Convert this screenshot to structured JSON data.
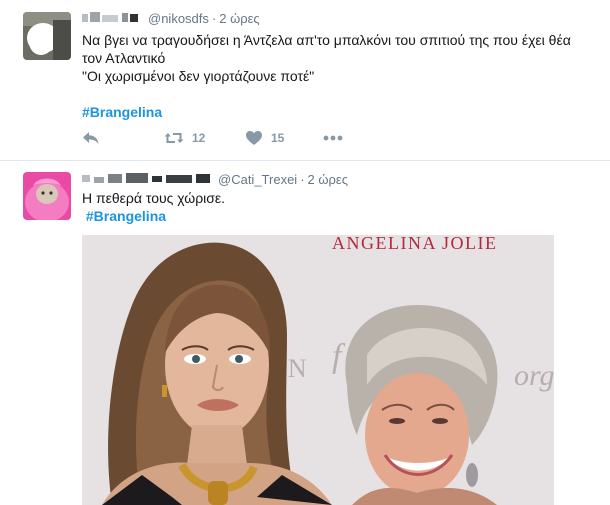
{
  "tweets": [
    {
      "handle": "@nikosdfs",
      "separator": "·",
      "time": "2 ώρες",
      "text_lines": [
        "Να βγει να τραγουδήσει η Άντζελα απ'το μπαλκόνι του σπιτιού της που έχει θέα",
        "τον Ατλαντικό",
        "\"Οι χωρισμένοι δεν γιορτάζουνε ποτέ\""
      ],
      "hashtag": "#Brangelina",
      "retweet_count": "12",
      "like_count": "15",
      "icons": [
        "reply-icon",
        "retweet-icon",
        "heart-icon",
        "more-dots-icon"
      ]
    },
    {
      "handle": "@Cati_Trexei",
      "separator": "·",
      "time": "2 ώρες",
      "text_lines": [
        "Η πεθερά τους χώρισε."
      ],
      "hashtag": "#Brangelina",
      "media_text": "ANGELINA JOLIE",
      "media_backdrop_fragments": [
        "EN",
        "f",
        "org"
      ]
    }
  ],
  "colors": {
    "hashtag": "#1b95e0",
    "meta": "#657786",
    "action_icon": "#8899a6",
    "divider": "#e1e8ed",
    "backdrop_red": "#b3283a"
  }
}
